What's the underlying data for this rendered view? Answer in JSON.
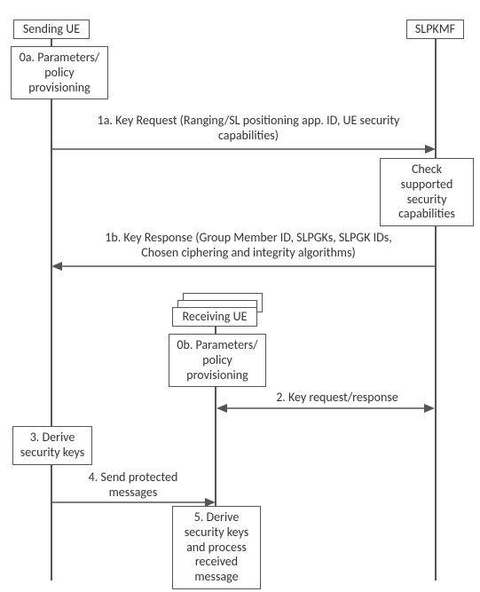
{
  "actors": {
    "sending_ue": "Sending UE",
    "slpkmf": "SLPKMF",
    "receiving_ue": "Receiving UE"
  },
  "notes": {
    "n0a": "0a. Parameters/ policy provisioning",
    "n_check": "Check supported security capabilities",
    "n0b": "0b. Parameters/ policy provisioning",
    "n3": "3. Derive security keys",
    "n5": "5. Derive security keys and process received message"
  },
  "messages": {
    "m1a_l1": "1a. Key Request (Ranging/SL positioning app. ID, UE security",
    "m1a_l2": "capabilities)",
    "m1b_l1": "1b. Key Response (Group Member ID, SLPGKs, SLPGK IDs,",
    "m1b_l2": "Chosen ciphering and integrity algorithms)",
    "m2": "2. Key request/response",
    "m4_l1": "4. Send protected",
    "m4_l2": "messages"
  },
  "chart_data": {
    "type": "sequence_diagram",
    "actors": [
      "Sending UE",
      "Receiving UE",
      "SLPKMF"
    ],
    "steps": [
      {
        "id": "0a",
        "at": "Sending UE",
        "kind": "self-action",
        "text": "Parameters/policy provisioning"
      },
      {
        "id": "1a",
        "from": "Sending UE",
        "to": "SLPKMF",
        "kind": "message",
        "text": "Key Request (Ranging/SL positioning app. ID, UE security capabilities)"
      },
      {
        "id": "check",
        "at": "SLPKMF",
        "kind": "self-action",
        "text": "Check supported security capabilities"
      },
      {
        "id": "1b",
        "from": "SLPKMF",
        "to": "Sending UE",
        "kind": "message",
        "text": "Key Response (Group Member ID, SLPGKs, SLPGK IDs, Chosen ciphering and integrity algorithms)"
      },
      {
        "id": "0b",
        "at": "Receiving UE",
        "kind": "self-action",
        "text": "Parameters/policy provisioning"
      },
      {
        "id": "2",
        "from": "Receiving UE",
        "to": "SLPKMF",
        "kind": "bidirectional",
        "text": "Key request/response"
      },
      {
        "id": "3",
        "at": "Sending UE",
        "kind": "self-action",
        "text": "Derive security keys"
      },
      {
        "id": "4",
        "from": "Sending UE",
        "to": "Receiving UE",
        "kind": "message",
        "text": "Send protected messages"
      },
      {
        "id": "5",
        "at": "Receiving UE",
        "kind": "self-action",
        "text": "Derive security keys and process received message"
      }
    ]
  }
}
